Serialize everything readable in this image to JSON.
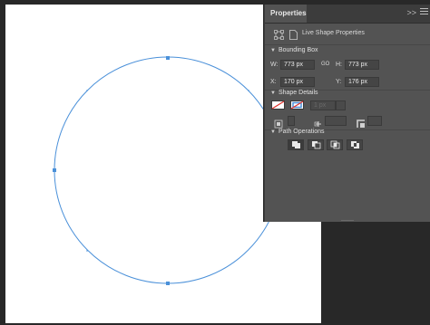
{
  "panel": {
    "tab_title": "Properties",
    "collapse_glyph": ">>",
    "header_label": "Live Shape Properties"
  },
  "bounding_box": {
    "section_label": "Bounding Box",
    "w_label": "W:",
    "w_value": "773 px",
    "link_glyph": "GO",
    "h_label": "H:",
    "h_value": "773 px",
    "x_label": "X:",
    "x_value": "170 px",
    "y_label": "Y:",
    "y_value": "176 px"
  },
  "shape_details": {
    "section_label": "Shape Details",
    "stroke_width_value": "1 px"
  },
  "path_operations": {
    "section_label": "Path Operations"
  },
  "colors": {
    "accent": "#4a90d9",
    "panel_bg": "#535353",
    "canvas_bg": "#ffffff",
    "workspace_bg": "#282828",
    "stroke_slash": "#e0302a"
  }
}
